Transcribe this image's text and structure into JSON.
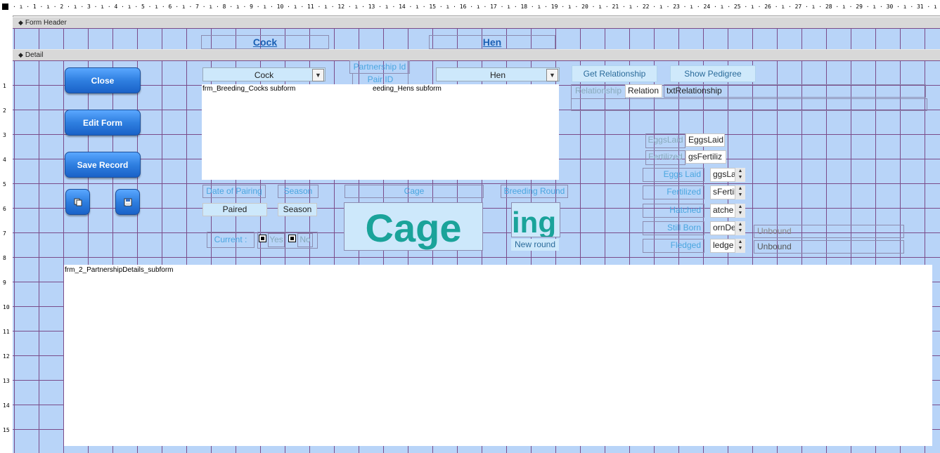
{
  "ruler": {
    "ticks": "· ı · 1 · ı · 2 · ı · 3 · ı · 4 · ı · 5 · ı · 6 · ı · 7 · ı · 8 · ı · 9 · ı · 10 · ı · 11 · ı · 12 · ı · 13 · ı · 14 · ı · 15 · ı · 16 · ı · 17 · ı · 18 · ı · 19 · ı · 20 · ı · 21 · ı · 22 · ı · 23 · ı · 24 · ı · 25 · ı · 26 · ı · 27 · ı · 28 · ı · 29 · ı · 30 · ı · 31 · ı · 32 · ı · 33 · ı · 34 · ı · 35 · ı · 36 · ı · 37 ·",
    "left_numbers": [
      "1",
      "2",
      "3",
      "4",
      "5",
      "6",
      "7",
      "8",
      "9",
      "10",
      "11",
      "12",
      "13",
      "14",
      "15"
    ]
  },
  "sections": {
    "form_header": "Form Header",
    "detail": "Detail"
  },
  "header": {
    "cock_link": "Cock",
    "hen_link": "Hen"
  },
  "buttons": {
    "close": "Close",
    "edit_form": "Edit Form",
    "save_record": "Save Record",
    "get_relationship": "Get Relationship",
    "show_pedigree": "Show Pedigree"
  },
  "combos": {
    "cock": "Cock",
    "hen": "Hen"
  },
  "labels": {
    "partnership_id": "Partnership Id",
    "pair_id": "Pair ID",
    "relationship": "Relationship",
    "relation_box": "Relation",
    "txt_relationship": "txtRelationship",
    "eggs_laid_top": "EggsLaid",
    "eggs_laid_top_value": "EggsLaid",
    "fertilized_top": "Fertilized",
    "fertilized_top_value": "gsFertiliz",
    "date_of_pairing": "Date of Pairing",
    "season": "Season",
    "cage": "Cage",
    "breeding_round": "Breeding Round",
    "paired_value": "Paired",
    "season_value": "Season",
    "cage_big": "Cage",
    "ing_big": "ing",
    "new_round": "New round",
    "current": "Current :",
    "yes": "Yes",
    "no": "No",
    "eggs_laid": "Eggs Laid",
    "fertilized": "Fertilized",
    "hatched": "Hatched",
    "still_born": "Still Born",
    "fledged": "Fledged",
    "eggs_laid_val": "ggsLa",
    "fertilized_val": "sFertil",
    "hatched_val": "atche",
    "still_born_val": "ornDe",
    "fledged_val": "ledge",
    "unbound1": "Unbound",
    "unbound2": "Unbound"
  },
  "subforms": {
    "cocks": "frm_Breeding_Cocks subform",
    "hens": "eeding_Hens subform",
    "partnership": "frm_2_PartnershipDetails_subform"
  },
  "colors": {
    "grid_bg": "#b8d4f8",
    "grid_line": "#7a4c8a",
    "label_text": "#4aa6e0",
    "cage_text": "#1aa39a",
    "button_blue": "#2f7fe0"
  },
  "icons": {
    "copy": "copy-record-icon",
    "save": "save-disk-icon"
  }
}
